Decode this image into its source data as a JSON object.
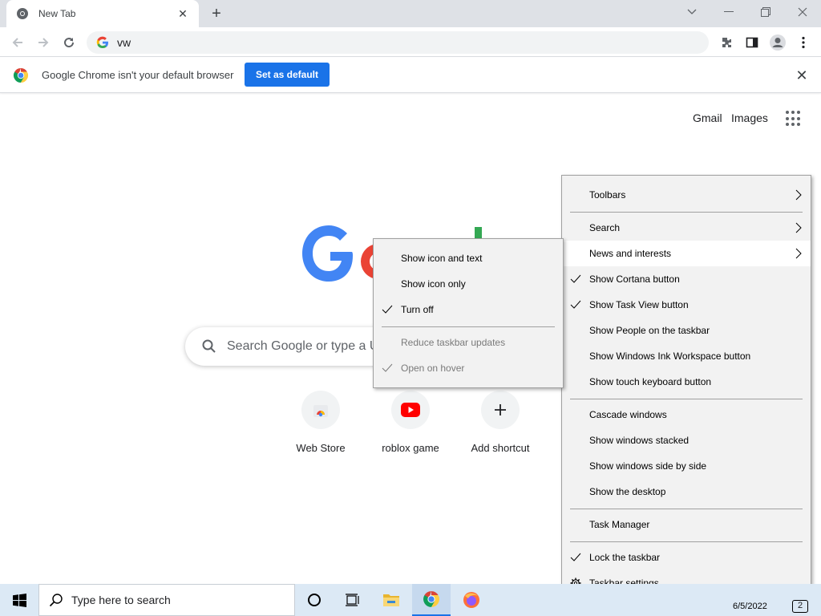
{
  "browser": {
    "tab_title": "New Tab",
    "address_value": "vw",
    "infobar_message": "Google Chrome isn't your default browser",
    "set_default_label": "Set as default"
  },
  "ntp": {
    "gmail_label": "Gmail",
    "images_label": "Images",
    "search_placeholder": "Search Google or type a U",
    "shortcuts": [
      {
        "label": "Web Store",
        "icon": "chrome-web-store-icon"
      },
      {
        "label": "roblox game",
        "icon": "youtube-icon"
      },
      {
        "label": "Add shortcut",
        "icon": "plus-icon"
      }
    ]
  },
  "taskbar_menu": {
    "items": [
      {
        "label": "Toolbars",
        "submenu": true
      },
      {
        "label": "Search",
        "submenu": true
      },
      {
        "label": "News and interests",
        "submenu": true,
        "highlighted": true
      },
      {
        "label": "Show Cortana button",
        "checked": true
      },
      {
        "label": "Show Task View button",
        "checked": true
      },
      {
        "label": "Show People on the taskbar"
      },
      {
        "label": "Show Windows Ink Workspace button"
      },
      {
        "label": "Show touch keyboard button"
      },
      {
        "label": "Cascade windows"
      },
      {
        "label": "Show windows stacked"
      },
      {
        "label": "Show windows side by side"
      },
      {
        "label": "Show the desktop"
      },
      {
        "label": "Task Manager"
      },
      {
        "label": "Lock the taskbar",
        "checked": true
      },
      {
        "label": "Taskbar settings",
        "icon": "gear-icon"
      }
    ]
  },
  "news_submenu": {
    "items": [
      {
        "label": "Show icon and text"
      },
      {
        "label": "Show icon only"
      },
      {
        "label": "Turn off",
        "checked": true
      },
      {
        "label": "Reduce taskbar updates",
        "disabled": true
      },
      {
        "label": "Open on hover",
        "checked": true,
        "disabled": true
      }
    ]
  },
  "taskbar": {
    "search_text": "Type here to search",
    "date": "6/5/2022",
    "notification_count": "2"
  },
  "colors": {
    "accent_blue": "#1a73e8",
    "taskbar_bg": "#dce9f5",
    "menu_bg": "#f2f2f2"
  }
}
